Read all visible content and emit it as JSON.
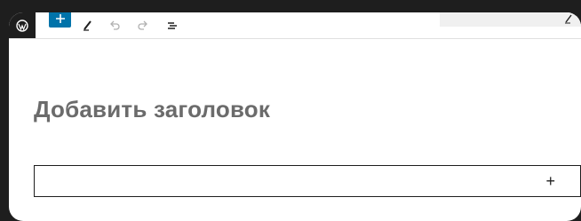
{
  "toolbar": {
    "logo_icon": "wordpress-icon",
    "inserter_icon": "plus-icon",
    "tools_icon": "pencil-icon",
    "undo_icon": "undo-icon",
    "redo_icon": "redo-icon",
    "list_view_icon": "list-view-icon",
    "accent_color": "#0073aa"
  },
  "editor": {
    "title_placeholder": "Добавить заголовок",
    "appender_label": "+"
  }
}
